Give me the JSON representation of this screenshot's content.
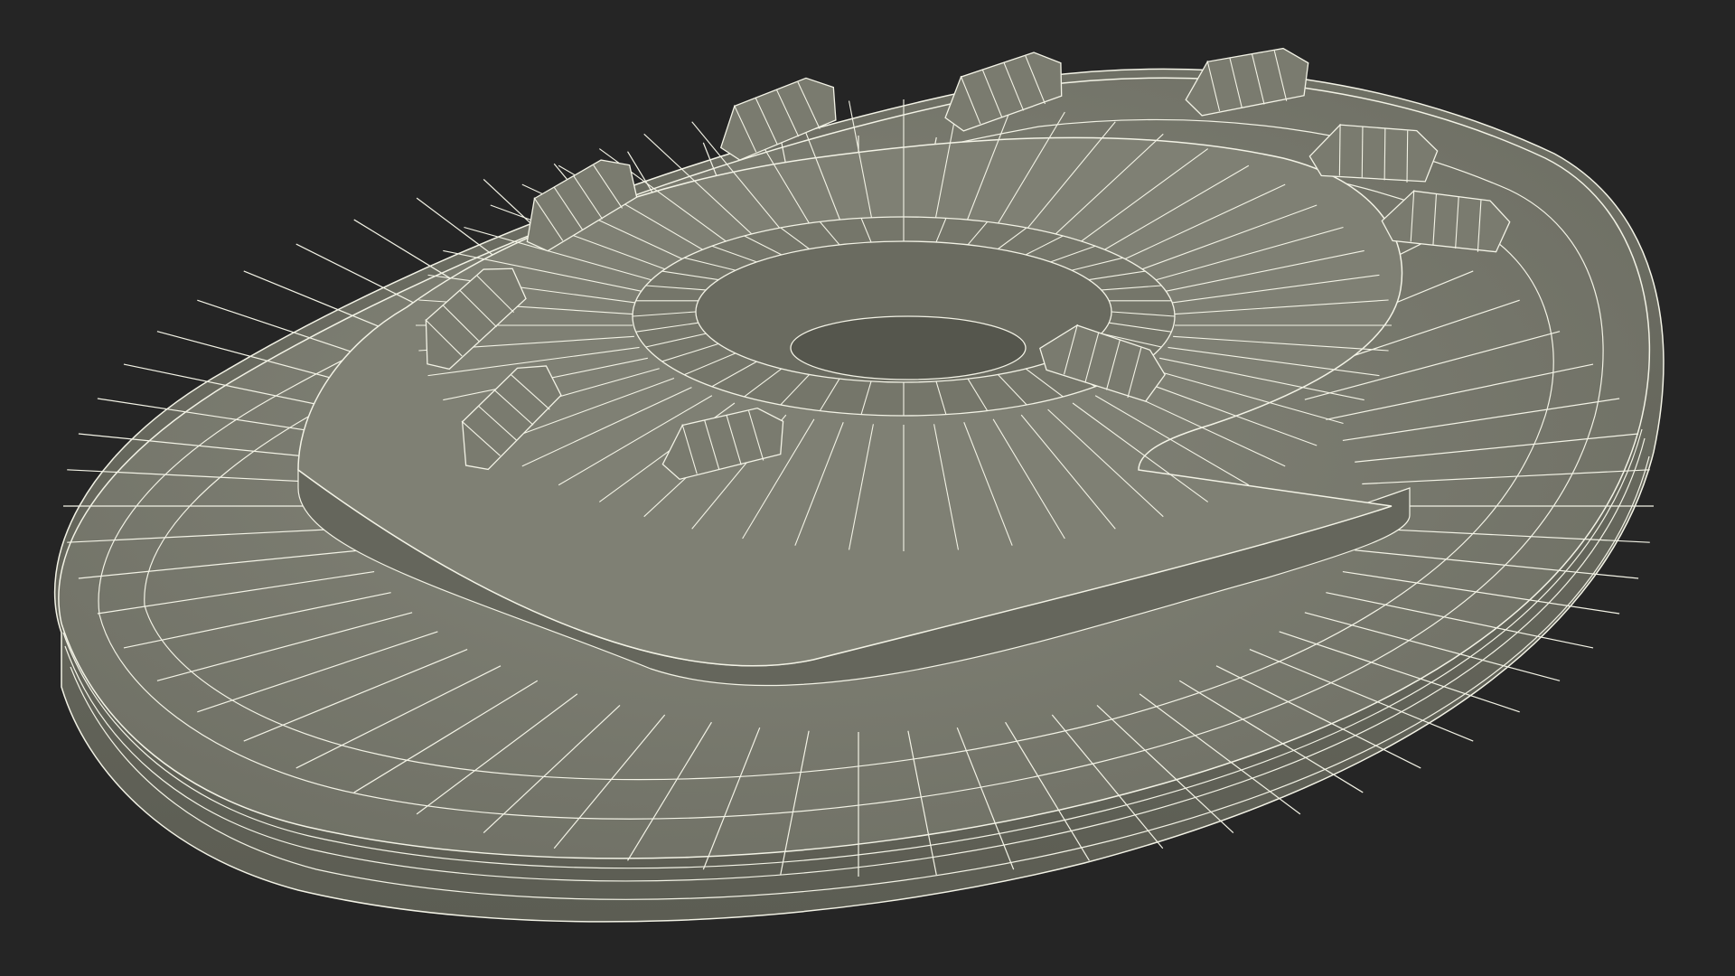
{
  "scene": {
    "background_color": "#252525",
    "mesh_fill_color": "#7b7c70",
    "mesh_shadow_color": "#5f6056",
    "mesh_highlight_color": "#8a8b7f",
    "wire_color": "#f3f3e6",
    "model_name": "wireframe-mesh-model",
    "view": "perspective"
  }
}
